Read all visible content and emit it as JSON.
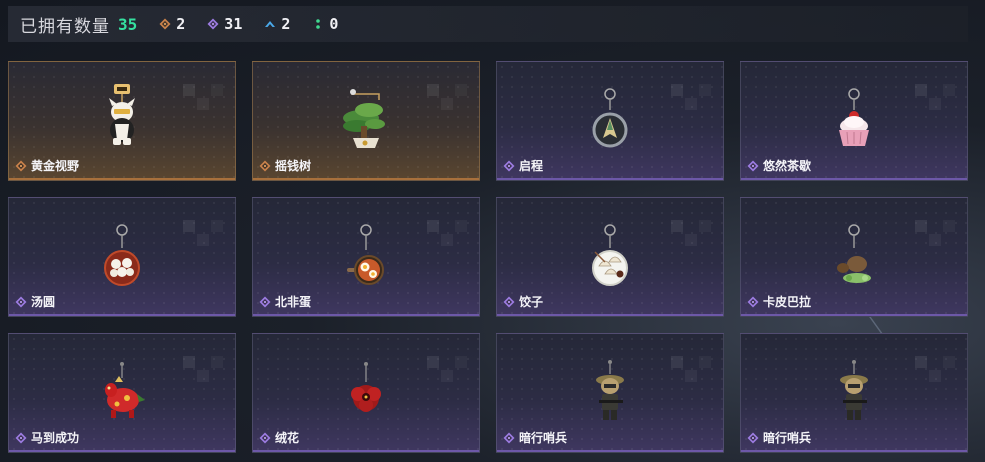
{
  "header": {
    "owned_label": "已拥有数量",
    "owned_count": "35",
    "rarity_counts": [
      {
        "icon": "gold-diamond-icon",
        "count": "2",
        "color": "#c8814a"
      },
      {
        "icon": "purple-diamond-icon",
        "count": "31",
        "color": "#9b7be0"
      },
      {
        "icon": "blue-chevron-icon",
        "count": "2",
        "color": "#4aa8e8"
      },
      {
        "icon": "green-dots-icon",
        "count": "0",
        "color": "#40d890"
      }
    ]
  },
  "colors": {
    "accent_green": "#35e0a0",
    "gold_rarity": "#c8814a",
    "purple_rarity": "#9b7be0"
  },
  "items": [
    {
      "name": "黄金视野",
      "rarity": "gold",
      "icon": "golden-cat-charm-icon"
    },
    {
      "name": "摇钱树",
      "rarity": "gold",
      "icon": "money-tree-charm-icon"
    },
    {
      "name": "启程",
      "rarity": "purple",
      "icon": "compass-charm-icon"
    },
    {
      "name": "悠然茶歇",
      "rarity": "purple",
      "icon": "cupcake-charm-icon"
    },
    {
      "name": "汤圆",
      "rarity": "purple",
      "icon": "tangyuan-bowl-charm-icon"
    },
    {
      "name": "北非蛋",
      "rarity": "purple",
      "icon": "shakshuka-pan-charm-icon"
    },
    {
      "name": "饺子",
      "rarity": "purple",
      "icon": "dumpling-plate-charm-icon"
    },
    {
      "name": "卡皮巴拉",
      "rarity": "purple",
      "icon": "capybara-charm-icon"
    },
    {
      "name": "马到成功",
      "rarity": "purple",
      "icon": "red-horse-charm-icon"
    },
    {
      "name": "绒花",
      "rarity": "purple",
      "icon": "velvet-flower-charm-icon"
    },
    {
      "name": "暗行哨兵",
      "rarity": "purple",
      "icon": "sentry-soldier-charm-icon"
    },
    {
      "name": "暗行哨兵",
      "rarity": "purple",
      "icon": "sentry-soldier-charm-icon"
    }
  ]
}
